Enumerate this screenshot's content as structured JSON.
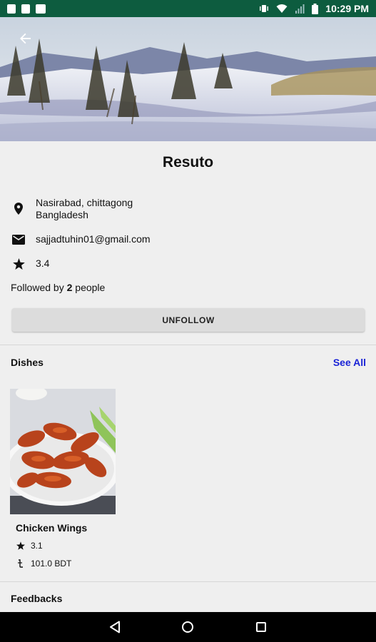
{
  "status_bar": {
    "time": "10:29 PM",
    "background": "#0d5c3f"
  },
  "restaurant": {
    "name": "Resuto",
    "address_line1": "Nasirabad, chittagong",
    "address_line2": "Bangladesh",
    "email": "sajjadtuhin01@gmail.com",
    "rating": "3.4"
  },
  "followers": {
    "prefix": "Followed by ",
    "count": "2",
    "suffix": " people"
  },
  "actions": {
    "unfollow_label": "UNFOLLOW"
  },
  "dishes_section": {
    "title": "Dishes",
    "see_all_label": "See All",
    "accent": "#1a23d6",
    "items": [
      {
        "name": "Chicken Wings",
        "rating": "3.1",
        "price": "101.0 BDT"
      }
    ]
  },
  "feedbacks_section": {
    "title": "Feedbacks"
  },
  "icons": {
    "back": "arrow-left-icon",
    "location": "location-pin-icon",
    "email": "mail-icon",
    "rating": "star-icon",
    "price": "currency-icon"
  }
}
